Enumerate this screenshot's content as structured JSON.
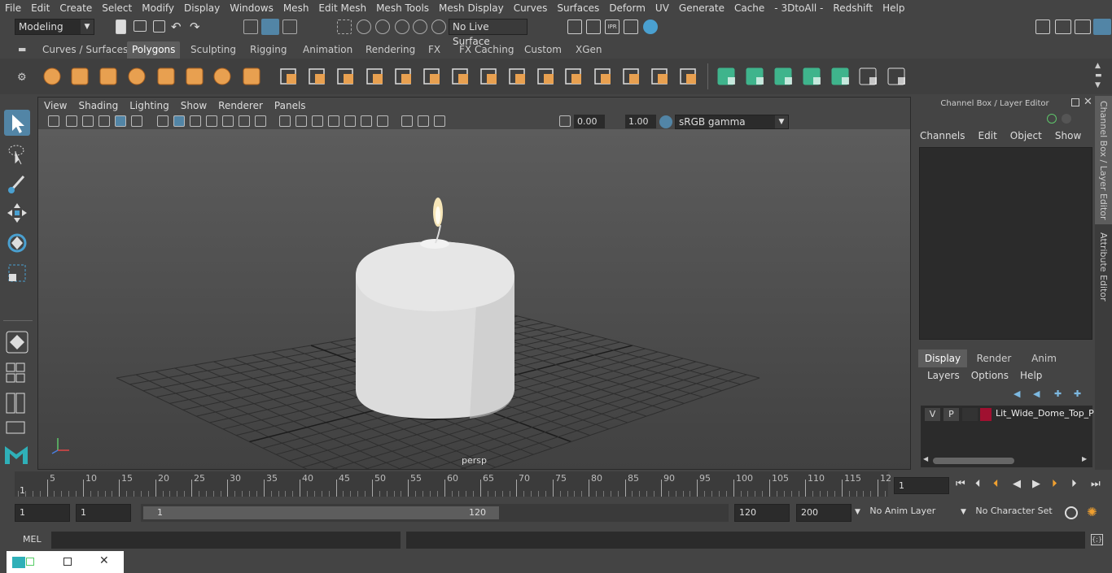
{
  "menubar": [
    "File",
    "Edit",
    "Create",
    "Select",
    "Modify",
    "Display",
    "Windows",
    "Mesh",
    "Edit Mesh",
    "Mesh Tools",
    "Mesh Display",
    "Curves",
    "Surfaces",
    "Deform",
    "UV",
    "Generate",
    "Cache",
    "- 3DtoAll -",
    "Redshift",
    "Help"
  ],
  "status": {
    "workspace": "Modeling",
    "live_surface": "No Live Surface"
  },
  "shelf_tabs": [
    "Curves / Surfaces",
    "Polygons",
    "Sculpting",
    "Rigging",
    "Animation",
    "Rendering",
    "FX",
    "FX Caching",
    "Custom",
    "XGen"
  ],
  "shelf_active": "Polygons",
  "viewport": {
    "menu": [
      "View",
      "Shading",
      "Lighting",
      "Show",
      "Renderer",
      "Panels"
    ],
    "exposure": "0.00",
    "gamma": "1.00",
    "color_space": "sRGB gamma",
    "camera_label": "persp"
  },
  "channel_box": {
    "title": "Channel Box / Layer Editor",
    "menu": [
      "Channels",
      "Edit",
      "Object",
      "Show"
    ]
  },
  "layer_editor": {
    "tabs": [
      "Display",
      "Render",
      "Anim"
    ],
    "active_tab": "Display",
    "menu": [
      "Layers",
      "Options",
      "Help"
    ],
    "layers": [
      {
        "v": "V",
        "p": "P",
        "name": "Lit_Wide_Dome_Top_P",
        "color": "#a01030"
      }
    ]
  },
  "side_tabs": [
    "Channel Box / Layer Editor",
    "Attribute Editor"
  ],
  "timeline": {
    "ticks": [
      "5",
      "10",
      "15",
      "20",
      "25",
      "30",
      "35",
      "40",
      "45",
      "50",
      "55",
      "60",
      "65",
      "70",
      "75",
      "80",
      "85",
      "90",
      "95",
      "100",
      "105",
      "110",
      "115",
      "12"
    ],
    "start_marker": "1",
    "current_frame": "1"
  },
  "range": {
    "start": "1",
    "playback_start": "1",
    "slider_start": "1",
    "slider_end": "120",
    "playback_end": "120",
    "end": "200",
    "anim_layer": "No Anim Layer",
    "character_set": "No Character Set"
  },
  "cmdline": {
    "label": "MEL"
  },
  "colors": {
    "accent": "#5285a6",
    "poly_icon": "#e8a050",
    "green_icon": "#3fb48c"
  }
}
